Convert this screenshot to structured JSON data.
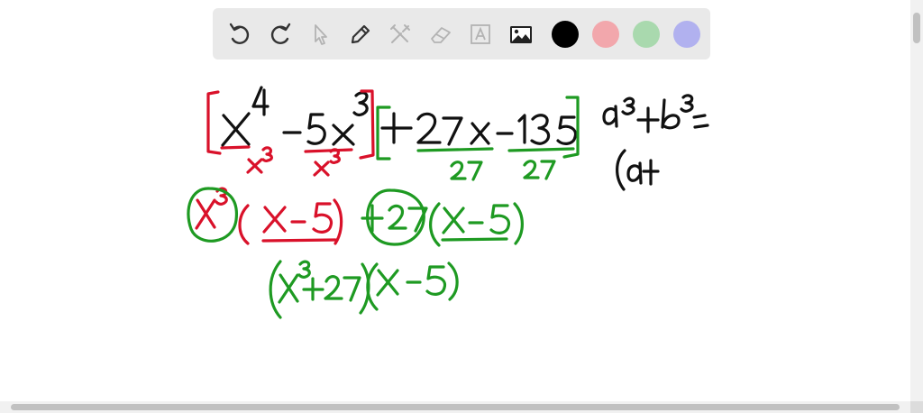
{
  "toolbar": {
    "tools": [
      {
        "name": "undo-icon",
        "enabled": true
      },
      {
        "name": "redo-icon",
        "enabled": true
      },
      {
        "name": "select-arrow-icon",
        "enabled": false
      },
      {
        "name": "pencil-icon",
        "enabled": true
      },
      {
        "name": "tools-icon",
        "enabled": false
      },
      {
        "name": "eraser-icon",
        "enabled": false
      },
      {
        "name": "text-icon",
        "enabled": false
      },
      {
        "name": "image-icon",
        "enabled": true
      }
    ],
    "colors": [
      {
        "name": "color-black",
        "hex": "#000000",
        "selected": true
      },
      {
        "name": "color-red",
        "hex": "#f2a7ac",
        "selected": false
      },
      {
        "name": "color-green",
        "hex": "#a9d9ae",
        "selected": false
      },
      {
        "name": "color-blue",
        "hex": "#b1b1ef",
        "selected": false
      }
    ]
  },
  "ink": {
    "black": "#111111",
    "red": "#d9112a",
    "green": "#1e9a22"
  }
}
